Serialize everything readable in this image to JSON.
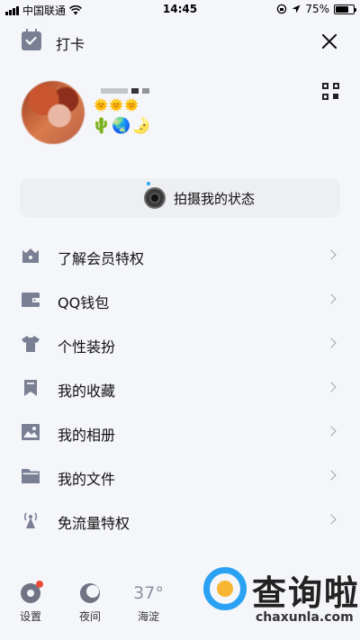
{
  "status_bar": {
    "carrier": "中国联通",
    "time": "14:45",
    "battery_text": "75%",
    "battery_level": 0.75
  },
  "header": {
    "title": "打卡",
    "checkin_icon": "calendar-check-icon",
    "close_icon": "close-icon"
  },
  "profile": {
    "level_badges": "🌞🌞🌞",
    "medal_badges": "🌵🌏🌛",
    "qr_icon": "qr-code-icon"
  },
  "status_capture": {
    "label": "拍摄我的状态",
    "icon": "camera-icon"
  },
  "menu": {
    "items": [
      {
        "label": "了解会员特权",
        "icon": "crown-icon"
      },
      {
        "label": "QQ钱包",
        "icon": "wallet-icon"
      },
      {
        "label": "个性装扮",
        "icon": "tshirt-icon"
      },
      {
        "label": "我的收藏",
        "icon": "bookmark-icon"
      },
      {
        "label": "我的相册",
        "icon": "photo-icon"
      },
      {
        "label": "我的文件",
        "icon": "folder-icon"
      },
      {
        "label": "免流量特权",
        "icon": "signal-tower-icon"
      }
    ]
  },
  "bottom_bar": {
    "settings_label": "设置",
    "night_label": "夜间",
    "weather_temp": "37°",
    "weather_city": "海淀"
  },
  "watermark": {
    "text": "查询啦",
    "url": "chaxunla.com"
  },
  "colors": {
    "icon_gray": "#7b7f93",
    "background": "#f5f6fa",
    "card": "#eeeff3",
    "notification_red": "#f04a3a",
    "watermark_blue": "#2aa1f2"
  }
}
